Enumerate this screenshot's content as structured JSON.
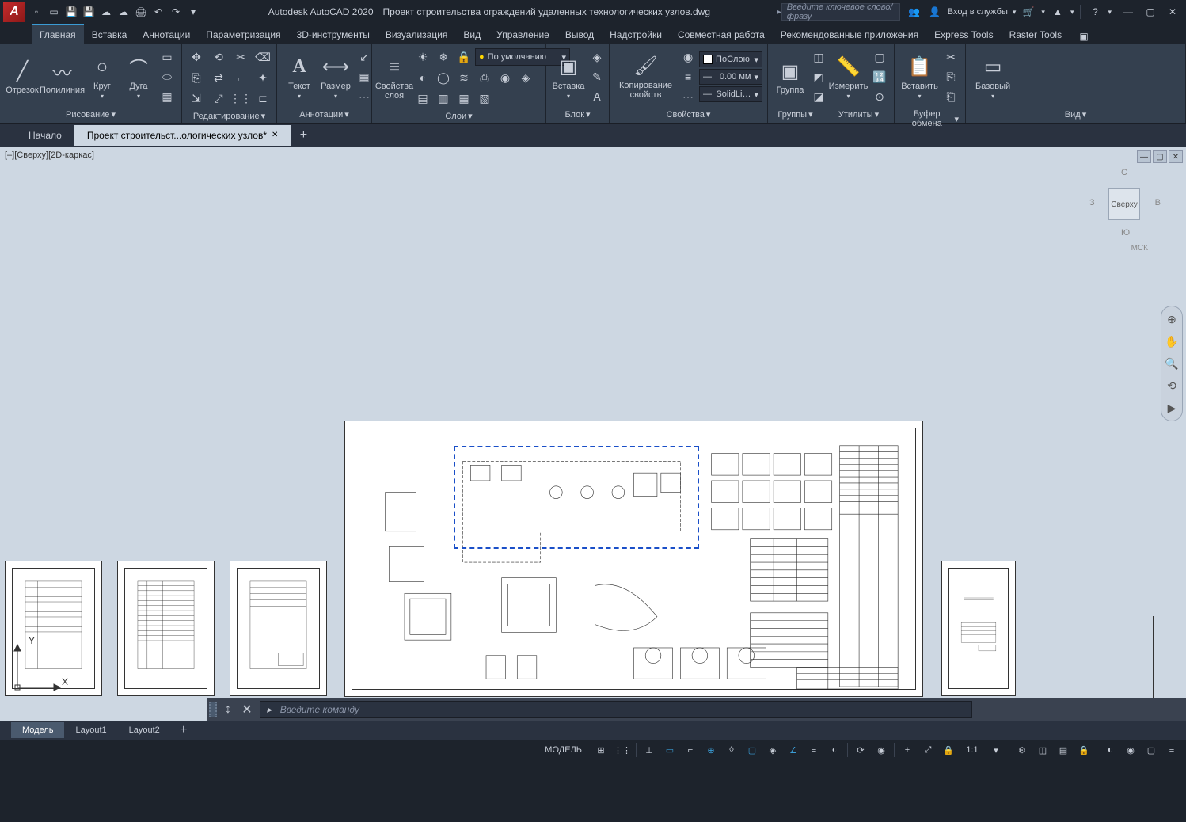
{
  "titlebar": {
    "app_name": "Autodesk AutoCAD 2020",
    "doc_name": "Проект строительства ограждений удаленных технологических узлов.dwg",
    "search_placeholder": "Введите ключевое слово/фразу",
    "signin": "Вход в службы"
  },
  "ribbon_tabs": [
    "Главная",
    "Вставка",
    "Аннотации",
    "Параметризация",
    "3D-инструменты",
    "Визуализация",
    "Вид",
    "Управление",
    "Вывод",
    "Надстройки",
    "Совместная работа",
    "Рекомендованные приложения",
    "Express Tools",
    "Raster Tools"
  ],
  "panels": {
    "draw": {
      "title": "Рисование",
      "line": "Отрезок",
      "pline": "Полилиния",
      "circle": "Круг",
      "arc": "Дуга"
    },
    "modify": {
      "title": "Редактирование"
    },
    "annot": {
      "title": "Аннотации",
      "text": "Текст",
      "dim": "Размер"
    },
    "layers": {
      "title": "Слои",
      "props": "Свойства\nслоя",
      "combo": "По умолчанию"
    },
    "block": {
      "title": "Блок",
      "insert": "Вставка"
    },
    "props": {
      "title": "Свойства",
      "copy": "Копирование\nсвойств",
      "color": "ПоСлою",
      "lw": "0.00 мм",
      "lt": "SolidLi…"
    },
    "groups": {
      "title": "Группы",
      "group": "Группа"
    },
    "utils": {
      "title": "Утилиты",
      "measure": "Измерить"
    },
    "clip": {
      "title": "Буфер обмена",
      "paste": "Вставить"
    },
    "view": {
      "title": "Вид",
      "base": "Базовый"
    }
  },
  "file_tabs": {
    "start": "Начало",
    "doc": "Проект строительст...ологических узлов*"
  },
  "viewport": {
    "label": "[–][Сверху][2D-каркас]",
    "cube": "Сверху",
    "wcs": "МСК",
    "north": "С",
    "south": "Ю",
    "east": "В",
    "west": "З"
  },
  "model_tabs": [
    "Модель",
    "Layout1",
    "Layout2"
  ],
  "cmdline": {
    "placeholder": "Введите команду"
  },
  "statusbar": {
    "model": "МОДЕЛЬ",
    "scale": "1:1"
  },
  "ucs": {
    "x": "X",
    "y": "Y"
  }
}
